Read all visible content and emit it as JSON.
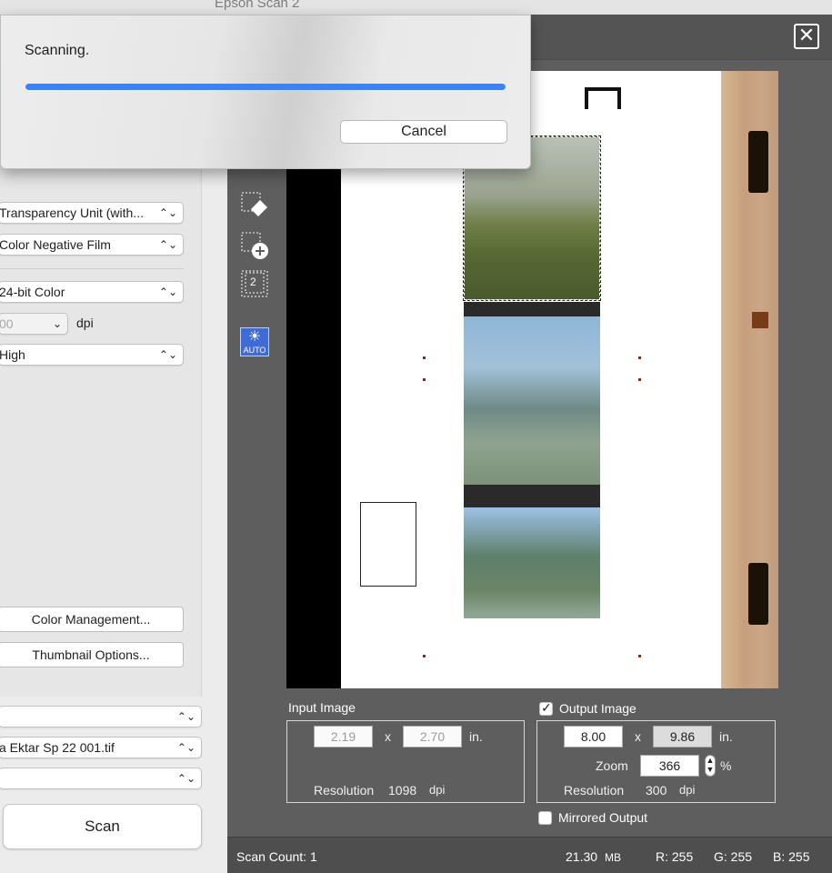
{
  "window": {
    "title": "Epson Scan 2"
  },
  "dialog": {
    "message": "Scanning.",
    "progress_percent": 100,
    "cancel_label": "Cancel"
  },
  "settings": {
    "document_source": "Transparency Unit (with...",
    "film_type": "Color Negative Film",
    "image_type": "24-bit Color",
    "resolution_value": "00",
    "resolution_unit": "dpi",
    "quality": "High",
    "color_management_label": "Color Management...",
    "thumbnail_options_label": "Thumbnail Options..."
  },
  "output": {
    "folder": "",
    "file_name": "a Ektar Sp 22 001.tif",
    "after_scan": ""
  },
  "scan_label": "Scan",
  "toolbar": {
    "frame_count": "2",
    "auto_label": "AUTO"
  },
  "input_image": {
    "label": "Input Image",
    "width": "2.19",
    "height": "2.70",
    "x_sep": "x",
    "unit": "in.",
    "resolution_label": "Resolution",
    "resolution_value": "1098",
    "resolution_unit": "dpi"
  },
  "output_image": {
    "label": "Output Image",
    "checked": true,
    "width": "8.00",
    "height": "9.86",
    "x_sep": "x",
    "unit": "in.",
    "zoom_label": "Zoom",
    "zoom_value": "366",
    "zoom_unit": "%",
    "resolution_label": "Resolution",
    "resolution_value": "300",
    "resolution_unit": "dpi"
  },
  "mirrored_output": {
    "label": "Mirrored Output",
    "checked": false
  },
  "status": {
    "scan_count": "Scan Count: 1",
    "file_size": "21.30",
    "file_size_unit": "MB",
    "r": "R: 255",
    "g": "G: 255",
    "b": "B: 255"
  },
  "colors": {
    "accent": "#3b82f6",
    "auto_icon": "#3f6bd6",
    "panel_dark": "#5e5e5e"
  }
}
